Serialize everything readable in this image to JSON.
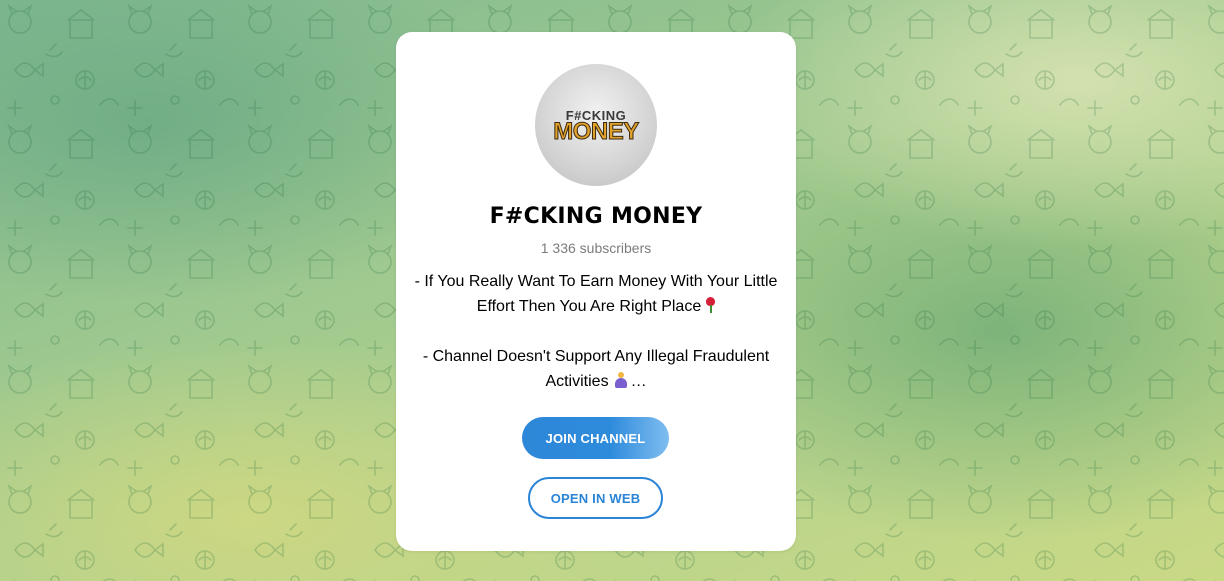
{
  "channel": {
    "avatar_top_text": "F#CKING",
    "avatar_main_text": "MONEY",
    "title": "F#CKING MONEY",
    "subscribers": "1 336 subscribers",
    "description_line1": "- If You Really Want To Earn Money With Your Little Effort Then You Are Right Place",
    "description_line2": "- Channel Doesn't Support Any Illegal Fraudulent Activities",
    "ellipsis": "…"
  },
  "actions": {
    "join_label": "JOIN CHANNEL",
    "web_label": "OPEN IN WEB"
  },
  "colors": {
    "accent": "#2b84d6",
    "card": "#ffffff",
    "subtitle": "#7c7c7c"
  },
  "icons": {
    "rose": "rose-emoji-icon",
    "pray": "praying-hands-emoji-icon"
  }
}
